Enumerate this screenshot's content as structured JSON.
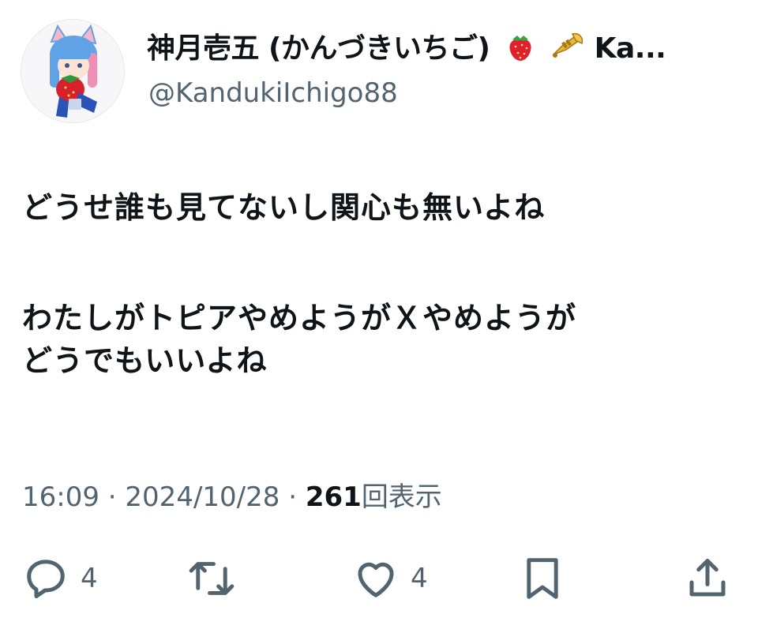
{
  "tweet": {
    "display_name": "神月壱五 (かんづきいちご)",
    "display_name_tail": "Ka...",
    "display_name_emojis": [
      "strawberry-icon",
      "trumpet-icon"
    ],
    "handle": "@KandukiIchigo88",
    "text_lines": [
      "どうせ誰も見てないし関心も無いよね",
      "わたしがトピアやめようがＸやめようが",
      "どうでもいいよね"
    ],
    "time": "16:09",
    "separator": "·",
    "date": "2024/10/28",
    "views_count": "261",
    "views_label": "回表示"
  },
  "actions": {
    "reply_count": "4",
    "like_count": "4"
  },
  "colors": {
    "text": "#0f1419",
    "secondary": "#536471",
    "background": "#ffffff"
  }
}
